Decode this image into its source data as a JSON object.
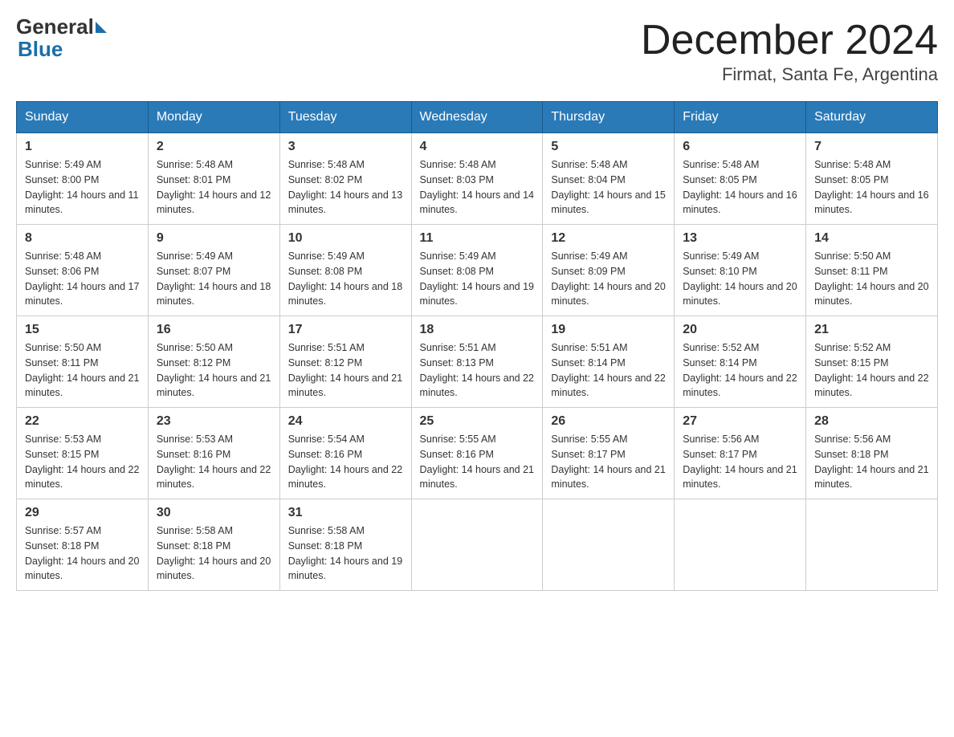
{
  "header": {
    "logo_general": "General",
    "logo_blue": "Blue",
    "title": "December 2024",
    "subtitle": "Firmat, Santa Fe, Argentina"
  },
  "days_of_week": [
    "Sunday",
    "Monday",
    "Tuesday",
    "Wednesday",
    "Thursday",
    "Friday",
    "Saturday"
  ],
  "weeks": [
    [
      {
        "day": "1",
        "sunrise": "5:49 AM",
        "sunset": "8:00 PM",
        "daylight": "14 hours and 11 minutes."
      },
      {
        "day": "2",
        "sunrise": "5:48 AM",
        "sunset": "8:01 PM",
        "daylight": "14 hours and 12 minutes."
      },
      {
        "day": "3",
        "sunrise": "5:48 AM",
        "sunset": "8:02 PM",
        "daylight": "14 hours and 13 minutes."
      },
      {
        "day": "4",
        "sunrise": "5:48 AM",
        "sunset": "8:03 PM",
        "daylight": "14 hours and 14 minutes."
      },
      {
        "day": "5",
        "sunrise": "5:48 AM",
        "sunset": "8:04 PM",
        "daylight": "14 hours and 15 minutes."
      },
      {
        "day": "6",
        "sunrise": "5:48 AM",
        "sunset": "8:05 PM",
        "daylight": "14 hours and 16 minutes."
      },
      {
        "day": "7",
        "sunrise": "5:48 AM",
        "sunset": "8:05 PM",
        "daylight": "14 hours and 16 minutes."
      }
    ],
    [
      {
        "day": "8",
        "sunrise": "5:48 AM",
        "sunset": "8:06 PM",
        "daylight": "14 hours and 17 minutes."
      },
      {
        "day": "9",
        "sunrise": "5:49 AM",
        "sunset": "8:07 PM",
        "daylight": "14 hours and 18 minutes."
      },
      {
        "day": "10",
        "sunrise": "5:49 AM",
        "sunset": "8:08 PM",
        "daylight": "14 hours and 18 minutes."
      },
      {
        "day": "11",
        "sunrise": "5:49 AM",
        "sunset": "8:08 PM",
        "daylight": "14 hours and 19 minutes."
      },
      {
        "day": "12",
        "sunrise": "5:49 AM",
        "sunset": "8:09 PM",
        "daylight": "14 hours and 20 minutes."
      },
      {
        "day": "13",
        "sunrise": "5:49 AM",
        "sunset": "8:10 PM",
        "daylight": "14 hours and 20 minutes."
      },
      {
        "day": "14",
        "sunrise": "5:50 AM",
        "sunset": "8:11 PM",
        "daylight": "14 hours and 20 minutes."
      }
    ],
    [
      {
        "day": "15",
        "sunrise": "5:50 AM",
        "sunset": "8:11 PM",
        "daylight": "14 hours and 21 minutes."
      },
      {
        "day": "16",
        "sunrise": "5:50 AM",
        "sunset": "8:12 PM",
        "daylight": "14 hours and 21 minutes."
      },
      {
        "day": "17",
        "sunrise": "5:51 AM",
        "sunset": "8:12 PM",
        "daylight": "14 hours and 21 minutes."
      },
      {
        "day": "18",
        "sunrise": "5:51 AM",
        "sunset": "8:13 PM",
        "daylight": "14 hours and 22 minutes."
      },
      {
        "day": "19",
        "sunrise": "5:51 AM",
        "sunset": "8:14 PM",
        "daylight": "14 hours and 22 minutes."
      },
      {
        "day": "20",
        "sunrise": "5:52 AM",
        "sunset": "8:14 PM",
        "daylight": "14 hours and 22 minutes."
      },
      {
        "day": "21",
        "sunrise": "5:52 AM",
        "sunset": "8:15 PM",
        "daylight": "14 hours and 22 minutes."
      }
    ],
    [
      {
        "day": "22",
        "sunrise": "5:53 AM",
        "sunset": "8:15 PM",
        "daylight": "14 hours and 22 minutes."
      },
      {
        "day": "23",
        "sunrise": "5:53 AM",
        "sunset": "8:16 PM",
        "daylight": "14 hours and 22 minutes."
      },
      {
        "day": "24",
        "sunrise": "5:54 AM",
        "sunset": "8:16 PM",
        "daylight": "14 hours and 22 minutes."
      },
      {
        "day": "25",
        "sunrise": "5:55 AM",
        "sunset": "8:16 PM",
        "daylight": "14 hours and 21 minutes."
      },
      {
        "day": "26",
        "sunrise": "5:55 AM",
        "sunset": "8:17 PM",
        "daylight": "14 hours and 21 minutes."
      },
      {
        "day": "27",
        "sunrise": "5:56 AM",
        "sunset": "8:17 PM",
        "daylight": "14 hours and 21 minutes."
      },
      {
        "day": "28",
        "sunrise": "5:56 AM",
        "sunset": "8:18 PM",
        "daylight": "14 hours and 21 minutes."
      }
    ],
    [
      {
        "day": "29",
        "sunrise": "5:57 AM",
        "sunset": "8:18 PM",
        "daylight": "14 hours and 20 minutes."
      },
      {
        "day": "30",
        "sunrise": "5:58 AM",
        "sunset": "8:18 PM",
        "daylight": "14 hours and 20 minutes."
      },
      {
        "day": "31",
        "sunrise": "5:58 AM",
        "sunset": "8:18 PM",
        "daylight": "14 hours and 19 minutes."
      },
      null,
      null,
      null,
      null
    ]
  ]
}
